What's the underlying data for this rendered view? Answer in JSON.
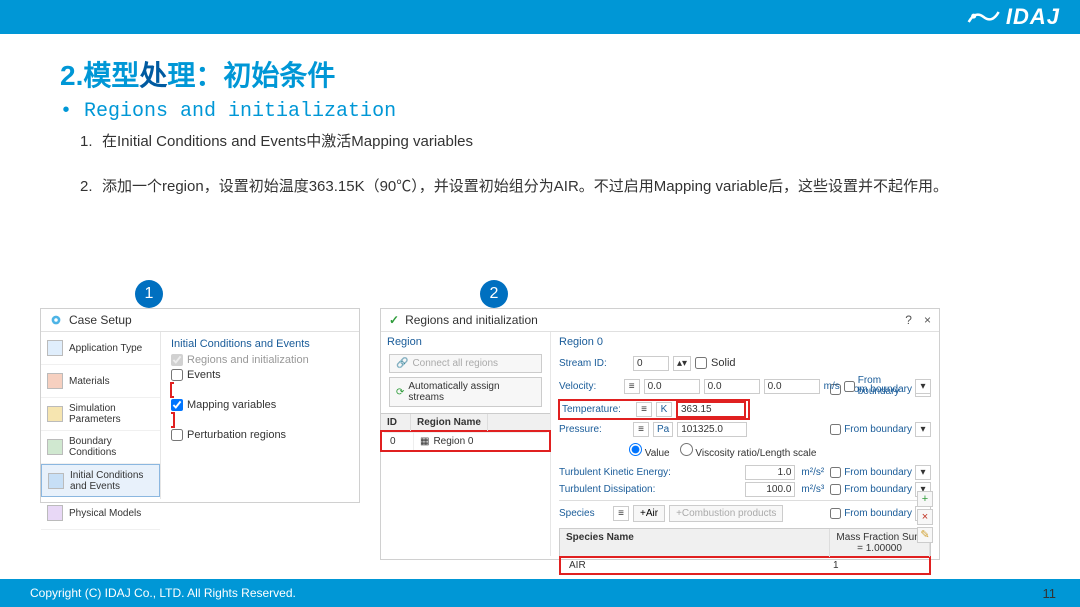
{
  "logo_text": "IDAJ",
  "title_prefix": "2.模型",
  "title_mid": "处",
  "title_suffix": "理：初始条件",
  "bullet_text": "Regions and initialization",
  "steps": [
    "在Initial Conditions and Events中激活Mapping variables",
    "添加一个region，设置初始温度363.15K（90℃），并设置初始组分为AIR。不过启用Mapping variable后，这些设置并不起作用。"
  ],
  "badge1": "1",
  "badge2": "2",
  "panel1": {
    "title": "Case Setup",
    "nav": [
      "Application Type",
      "Materials",
      "Simulation Parameters",
      "Boundary Conditions",
      "Initial Conditions and Events",
      "Physical Models"
    ],
    "opts_header": "Initial Conditions and Events",
    "opts": [
      {
        "label": "Regions and initialization",
        "checked": true,
        "dim": true
      },
      {
        "label": "Events",
        "checked": false,
        "dim": false
      },
      {
        "label": "Mapping variables",
        "checked": true,
        "dim": false,
        "highlight": true
      },
      {
        "label": "Perturbation regions",
        "checked": false,
        "dim": false
      }
    ]
  },
  "panel2": {
    "title": "Regions and initialization",
    "help": "?",
    "close": "×",
    "region_label": "Region",
    "connect": "Connect all regions",
    "auto": "Automatically assign streams",
    "id_header": "ID",
    "name_header": "Region Name",
    "row_id": "0",
    "row_name": "Region 0",
    "right_title": "Region 0",
    "stream_id_label": "Stream ID:",
    "stream_id_value": "0",
    "solid_label": "Solid",
    "velocity_label": "Velocity:",
    "velocity_x": "0.0",
    "velocity_y": "0.0",
    "velocity_z": "0.0",
    "velocity_unit": "m/s",
    "temperature_label": "Temperature:",
    "temperature_unit": "K",
    "temperature_value": "363.15",
    "pressure_label": "Pressure:",
    "pressure_unit": "Pa",
    "pressure_value": "101325.0",
    "from_boundary": "From boundary",
    "rad_value": "Value",
    "rad_visc": "Viscosity ratio/Length scale",
    "tke_label": "Turbulent Kinetic Energy:",
    "tke_value": "1.0",
    "tke_unit": "m²/s²",
    "td_label": "Turbulent Dissipation:",
    "td_value": "100.0",
    "td_unit": "m²/s³",
    "species_label": "Species",
    "air_btn": "+Air",
    "comb_btn": "+Combustion products",
    "sp_name_header": "Species Name",
    "sp_mass_header": "Mass Fraction Sum = 1.00000",
    "sp_air": "AIR",
    "sp_air_val": "1"
  },
  "footer": "Copyright (C)  IDAJ Co., LTD. All Rights Reserved.",
  "page_num": "11"
}
